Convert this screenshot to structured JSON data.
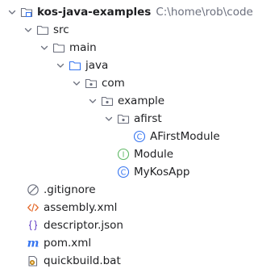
{
  "project": {
    "name": "kos-java-examples",
    "path": "C:\\home\\rob\\code"
  },
  "tree": {
    "src": "src",
    "main": "main",
    "java": "java",
    "com": "com",
    "example": "example",
    "afirst": "afirst",
    "class_afirstmodule": "AFirstModule",
    "interface_module": "Module",
    "class_mykosapp": "MyKosApp",
    "gitignore": ".gitignore",
    "assembly": "assembly.xml",
    "descriptor": "descriptor.json",
    "pom": "pom.xml",
    "quickbuild": "quickbuild.bat"
  },
  "icons": {
    "class_badge": "C",
    "interface_badge": "I",
    "maven_badge": "m"
  },
  "colors": {
    "folder_stroke": "#6c707e",
    "source_folder_stroke": "#3574f0",
    "class_icon": "#3574f0",
    "interface_icon": "#5fb865",
    "xml_icon": "#e56b2d",
    "json_icon": "#7b5ccf",
    "maven_icon": "#3574f0",
    "path_text": "#6c707e",
    "text": "#1e1f22"
  }
}
